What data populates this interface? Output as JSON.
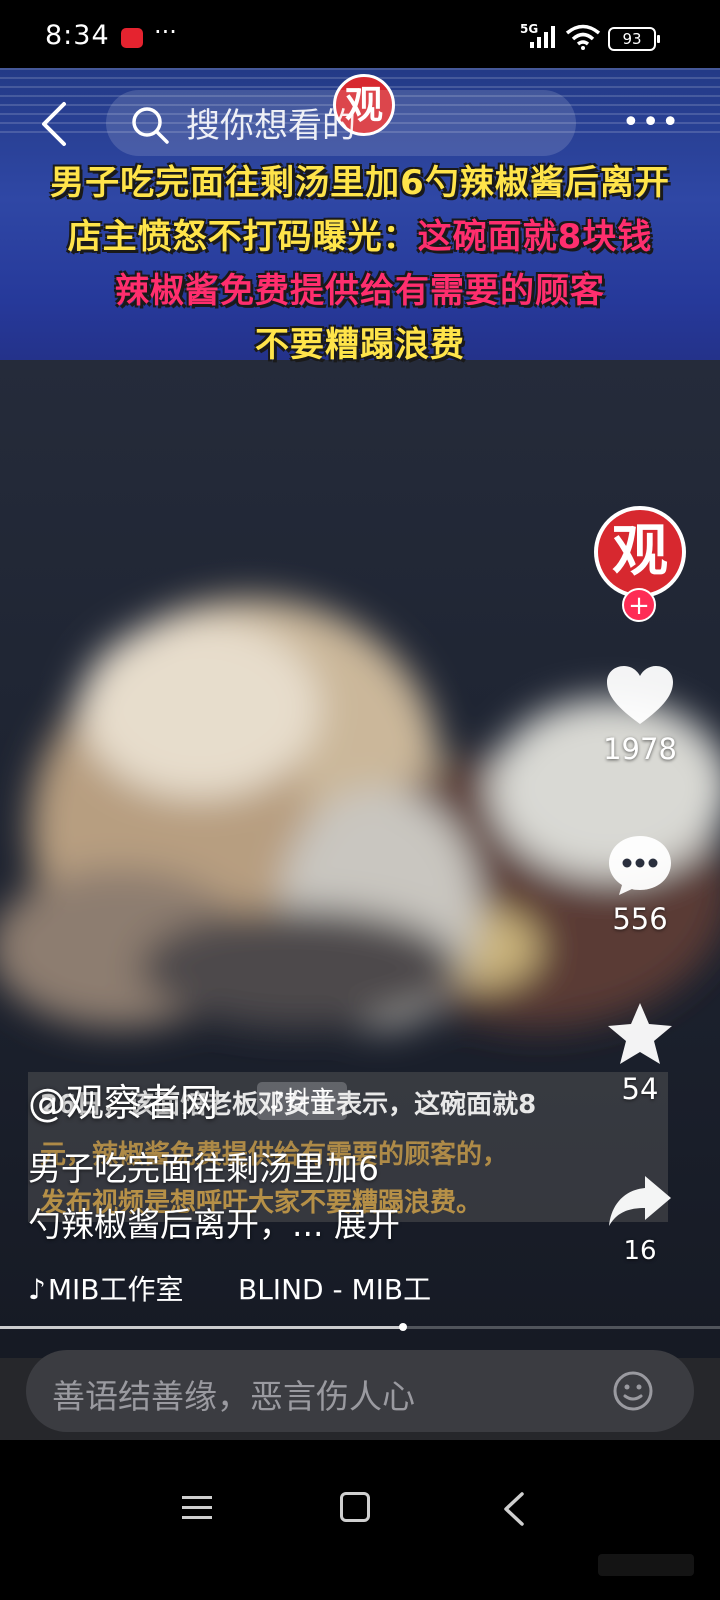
{
  "status_bar": {
    "time": "8:34",
    "dots": "···",
    "network": "5G",
    "battery": "93"
  },
  "search": {
    "placeholder_text": "搜你想看的"
  },
  "banner": {
    "logo_char": "观",
    "line1": "男子吃完面往剩汤里加6勺辣椒酱后离开",
    "line2_a": "店主愤怒不打码曝光：",
    "line2_b": "这碗面就8块钱",
    "line3": "辣椒酱免费提供给有需要的顾客",
    "line4": "不要糟蹋浪费"
  },
  "rail": {
    "avatar_char": "观",
    "follow": "+",
    "likes": "1978",
    "comments": "556",
    "favorites": "54",
    "shares": "16"
  },
  "subtitle": {
    "line1": "26日，该面馆老板邓女士表示，这碗面就8",
    "line2": "元，辣椒酱免费提供给有需要的顾客的，",
    "line3": "发布视频是想呼吁大家不要糟蹋浪费。"
  },
  "video_info": {
    "author": "@观察者网",
    "tag": "♪抖音",
    "desc_line1": "男子吃完面往剩汤里加6",
    "desc_line2": "勺辣椒酱后离开，... ",
    "expand": "展开",
    "music_source": "MIB工作室",
    "music_track": "BLIND - MIB工"
  },
  "playback": {
    "progress_fraction": 0.56
  },
  "comment": {
    "placeholder": "善语结善缘，恶言伤人心"
  }
}
